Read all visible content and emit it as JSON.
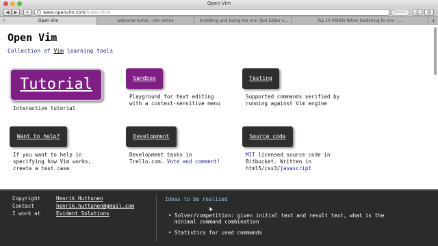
{
  "window": {
    "title": "Open Vim"
  },
  "toolbar": {
    "back_label": "◀",
    "forward_label": "▶",
    "add_label": "+",
    "url_domain": "www.openvim.com",
    "url_path": "/index.html",
    "reader_label": "Reader",
    "share_label": "⎙",
    "settings_label": "⚙"
  },
  "tabs": [
    {
      "label": "Open Vim",
      "active": true
    },
    {
      "label": "welcome home : vim online",
      "active": false
    },
    {
      "label": "Installing and Using the Vim Text Editor o...",
      "active": false
    },
    {
      "label": "Top 10 Pitfalls When Switching to Vim - ...",
      "active": false
    }
  ],
  "tabbar": {
    "add_label": "+"
  },
  "header": {
    "title": "Open Vim",
    "subtitle_before": "Collection of",
    "subtitle_link": "Vim",
    "subtitle_after": "learning tools"
  },
  "cards": {
    "tutorial": {
      "label": "Tutorial",
      "desc": "Interactive tutorial"
    },
    "sandbox": {
      "label": "Sandbox",
      "desc": "Playground for text editing\nwith a context-sensitive menu"
    },
    "testing": {
      "label": "Testing",
      "desc": "Supported commands verified by\nrunning against Vim engine"
    },
    "help": {
      "label": "Want to help?",
      "desc": "If you want to help in\nspecifying how Vim works,\ncreate a test case."
    },
    "development": {
      "label": "Development",
      "desc_1": "Development tasks in\nTrello.com.",
      "desc_link": "Vote and comment!"
    },
    "source": {
      "label": "Source code",
      "desc_link1": "MIT",
      "desc_1": " licensed source code in\nBitbucket. Written in\nhtml5/css3/",
      "desc_link2": "javascript"
    }
  },
  "footer": {
    "contacts": [
      {
        "label": "Copyright",
        "value": "Henrik Huttunen"
      },
      {
        "label": "Contact",
        "value": "henrik.huttunen@gmail.com"
      },
      {
        "label": "I work at",
        "value": "Evident Solutions"
      }
    ],
    "ideas_title": "Ideas to be realized",
    "ideas": [
      "Solver/competition: given initial text and result text, what is the minimal command combination",
      "Statistics for used commands"
    ]
  },
  "colors": {
    "accent_purple": "#7f1f86",
    "button_dark": "#2f2f2f",
    "footer_bg": "#2b2b2b",
    "link_blue": "#1a1a8c",
    "ideas_title": "#8ec8e8"
  }
}
